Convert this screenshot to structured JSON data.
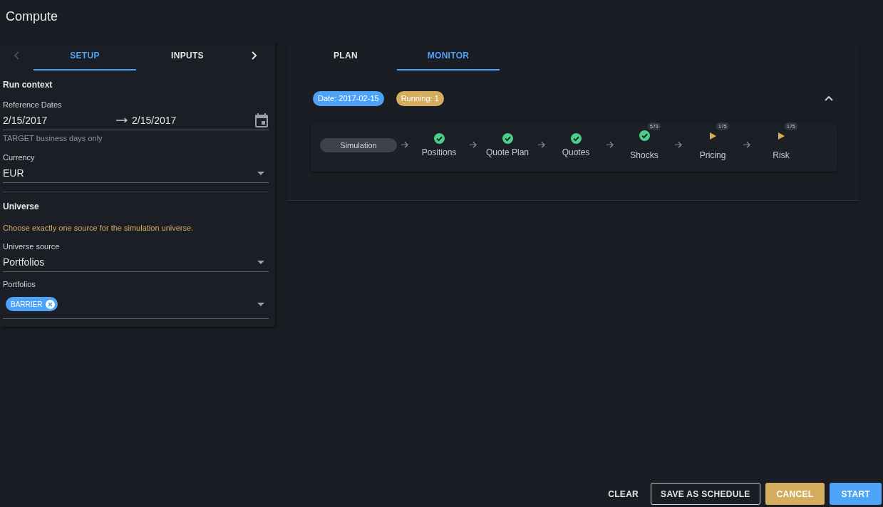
{
  "header": {
    "title": "Compute"
  },
  "setup_panel": {
    "scroll_buttons": [
      {
        "kind": "prev",
        "disabled": true
      },
      {
        "kind": "next",
        "disabled": false
      }
    ],
    "tabs": [
      {
        "label": "SETUP",
        "selected": true
      },
      {
        "label": "INPUTS",
        "selected": false
      }
    ],
    "run_context": {
      "heading": "Run context",
      "reference_dates": {
        "label": "Reference Dates",
        "start": "2/15/2017",
        "end": "2/15/2017",
        "helper": "TARGET business days only"
      },
      "currency": {
        "label": "Currency",
        "value": "EUR"
      }
    },
    "universe": {
      "heading": "Universe",
      "warning": "Choose exactly one source for the simulation universe.",
      "universe_source": {
        "label": "Universe source",
        "value": "Portfolios"
      },
      "portfolios": {
        "label": "Portfolios",
        "chips": [
          "BARRIER"
        ]
      }
    }
  },
  "monitor_panel": {
    "tabs": [
      {
        "label": "PLAN",
        "selected": false
      },
      {
        "label": "MONITOR",
        "selected": true
      }
    ],
    "run": {
      "chips": [
        {
          "label": "Date: 2017-02-15",
          "color": "#4da3f7"
        },
        {
          "label": "Running: 1",
          "color": "#d4ae5e"
        }
      ],
      "expanded": true,
      "pipeline": [
        {
          "kind": "source",
          "label": "Simulation"
        },
        {
          "kind": "done",
          "label": "Positions"
        },
        {
          "kind": "done",
          "label": "Quote Plan"
        },
        {
          "kind": "done",
          "label": "Quotes"
        },
        {
          "kind": "done",
          "label": "Shocks",
          "count": "573"
        },
        {
          "kind": "running",
          "label": "Pricing",
          "count": "175"
        },
        {
          "kind": "running",
          "label": "Risk",
          "count": "175"
        }
      ]
    }
  },
  "actions": [
    {
      "kind": "text",
      "label": "CLEAR"
    },
    {
      "kind": "outlined",
      "label": "SAVE AS SCHEDULE"
    },
    {
      "kind": "warning",
      "label": "CANCEL"
    },
    {
      "kind": "primary",
      "label": "START"
    }
  ]
}
